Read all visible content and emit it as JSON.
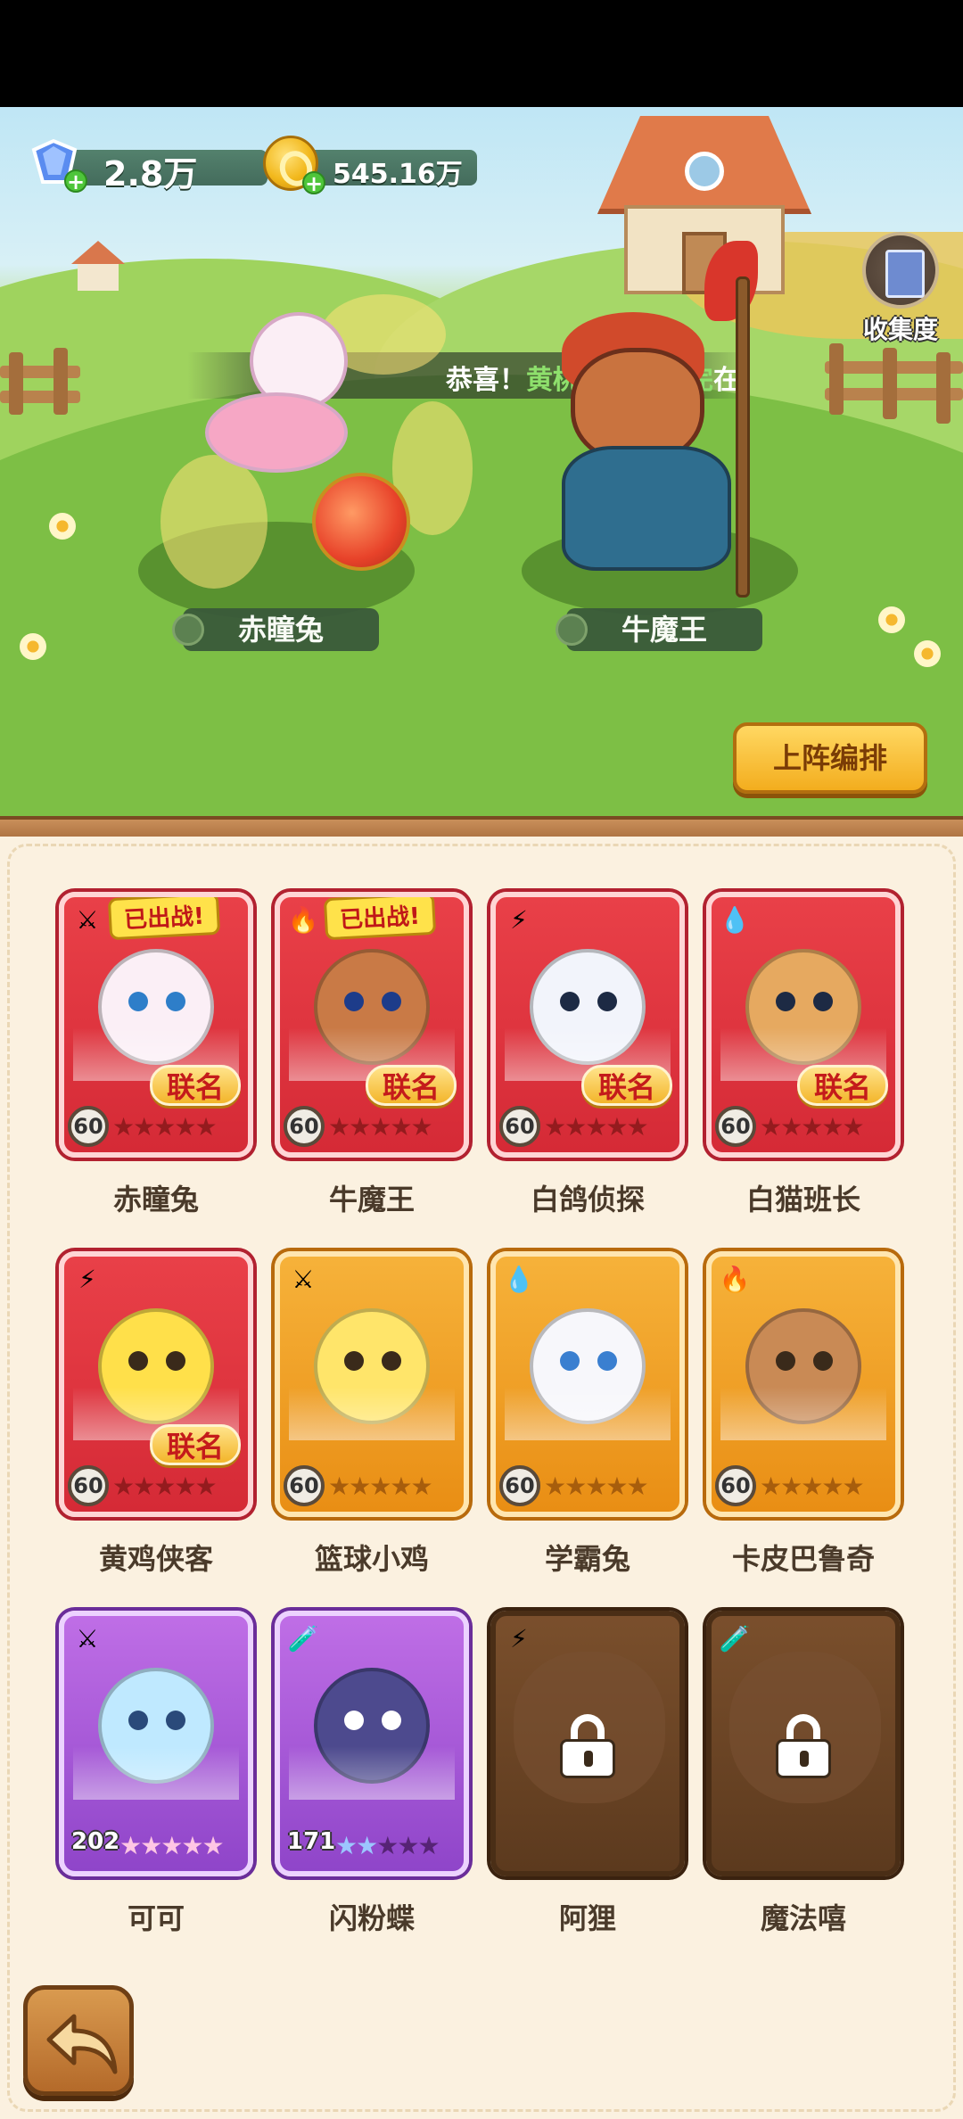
{
  "currency": {
    "gems": {
      "icon": "gem-icon",
      "value": "2.8万"
    },
    "coins": {
      "icon": "coin-icon",
      "value": "545.16万"
    }
  },
  "collection": {
    "icon": "collection-book-icon",
    "label": "收集度"
  },
  "notice": {
    "prefix": "恭喜！",
    "highlight": "黄桃苹果消不完",
    "truncated_char": "在"
  },
  "lineup": [
    {
      "name": "赤瞳兔"
    },
    {
      "name": "牛魔王"
    }
  ],
  "buttons": {
    "lineup_edit": "上阵编排",
    "back_icon": "back-arrow-icon"
  },
  "cards": [
    {
      "name": "赤瞳兔",
      "rarity": "red",
      "element": "sword",
      "element_glyph": "⚔",
      "level": "60",
      "stars_lit": 0,
      "deployed": "已出战!",
      "collab": "联名"
    },
    {
      "name": "牛魔王",
      "rarity": "red",
      "element": "fire",
      "element_glyph": "🔥",
      "level": "60",
      "stars_lit": 0,
      "deployed": "已出战!",
      "collab": "联名"
    },
    {
      "name": "白鸽侦探",
      "rarity": "red",
      "element": "lightning",
      "element_glyph": "⚡",
      "level": "60",
      "stars_lit": 0,
      "deployed": "",
      "collab": "联名"
    },
    {
      "name": "白猫班长",
      "rarity": "red",
      "element": "water",
      "element_glyph": "💧",
      "level": "60",
      "stars_lit": 0,
      "deployed": "",
      "collab": "联名"
    },
    {
      "name": "黄鸡侠客",
      "rarity": "red",
      "element": "lightning",
      "element_glyph": "⚡",
      "level": "60",
      "stars_lit": 0,
      "deployed": "",
      "collab": "联名"
    },
    {
      "name": "篮球小鸡",
      "rarity": "orange",
      "element": "sword",
      "element_glyph": "⚔",
      "level": "60",
      "stars_lit": 0,
      "deployed": "",
      "collab": ""
    },
    {
      "name": "学霸兔",
      "rarity": "orange",
      "element": "water",
      "element_glyph": "💧",
      "level": "60",
      "stars_lit": 0,
      "deployed": "",
      "collab": ""
    },
    {
      "name": "卡皮巴鲁奇",
      "rarity": "orange",
      "element": "fire",
      "element_glyph": "🔥",
      "level": "60",
      "stars_lit": 0,
      "deployed": "",
      "collab": ""
    },
    {
      "name": "可可",
      "rarity": "purple",
      "element": "sword",
      "element_glyph": "⚔",
      "level": "202",
      "stars_lit": 5,
      "deployed": "",
      "collab": ""
    },
    {
      "name": "闪粉蝶",
      "rarity": "purple",
      "element": "poison",
      "element_glyph": "🧪",
      "level": "171",
      "stars_lit": 2,
      "deployed": "",
      "collab": ""
    },
    {
      "name": "阿狸",
      "rarity": "locked",
      "element": "lightning",
      "element_glyph": "⚡",
      "level": "",
      "stars_lit": 0,
      "deployed": "",
      "collab": "",
      "locked": true
    },
    {
      "name": "魔法嘻",
      "rarity": "locked",
      "element": "poison",
      "element_glyph": "🧪",
      "level": "",
      "stars_lit": 0,
      "deployed": "",
      "collab": "",
      "locked": true
    }
  ]
}
